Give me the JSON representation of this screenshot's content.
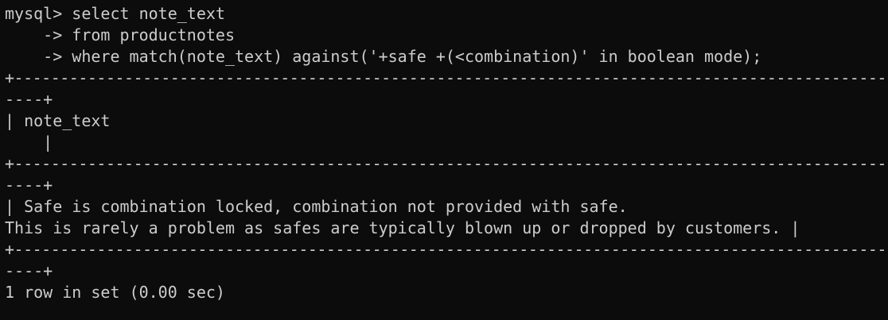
{
  "terminal": {
    "lines": [
      "mysql> select note_text",
      "    -> from productnotes",
      "    -> where match(note_text) against('+safe +(<combination)' in boolean mode);",
      "+-------------------------------------------------------------------------------------------------",
      "----+",
      "| note_text",
      "    |",
      "+-------------------------------------------------------------------------------------------------",
      "----+",
      "| Safe is combination locked, combination not provided with safe.",
      "This is rarely a problem as safes are typically blown up or dropped by customers. |",
      "+-------------------------------------------------------------------------------------------------",
      "----+",
      "1 row in set (0.00 sec)"
    ]
  },
  "colors": {
    "background": "#0c0c0c",
    "foreground": "#cccccc"
  }
}
